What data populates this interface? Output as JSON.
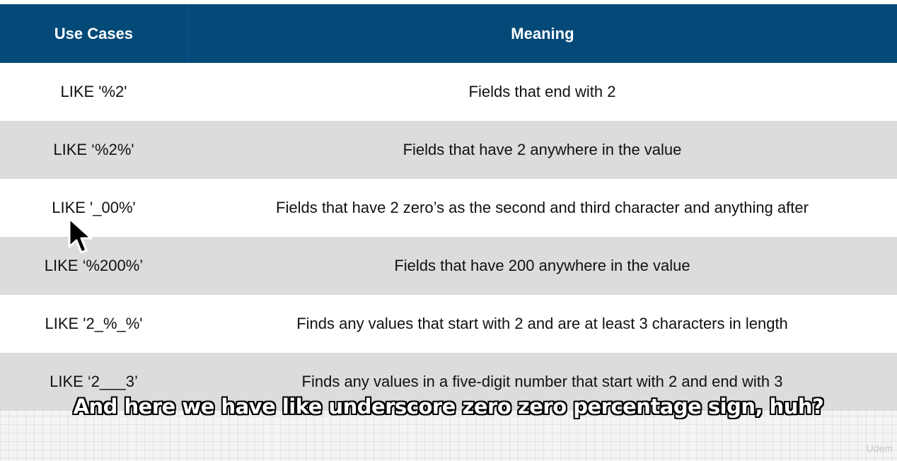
{
  "table": {
    "headers": [
      "Use Cases",
      "Meaning"
    ],
    "rows": [
      {
        "use_case": "LIKE '%2'",
        "meaning": "Fields that end with 2"
      },
      {
        "use_case": "LIKE ‘%2%'",
        "meaning": "Fields that have 2 anywhere in the value"
      },
      {
        "use_case": "LIKE '_00%'",
        "meaning": "Fields that have 2 zero’s as the second and third character and anything after"
      },
      {
        "use_case": "LIKE ‘%200%’",
        "meaning": "Fields that have 200 anywhere in the value"
      },
      {
        "use_case": "LIKE '2_%_%'",
        "meaning": "Finds any values that start with 2 and are at least 3 characters in length"
      },
      {
        "use_case": "LIKE ‘2___3’",
        "meaning": "Finds any values in a five-digit number that start with 2 and end with 3"
      }
    ]
  },
  "subtitle": "And here we have like underscore zero zero percentage sign, huh?",
  "watermark": "Udem",
  "colors": {
    "header_bg": "#044a79",
    "row_alt_bg": "#dcdcdc"
  },
  "cursor": {
    "icon": "mouse-pointer-icon"
  }
}
